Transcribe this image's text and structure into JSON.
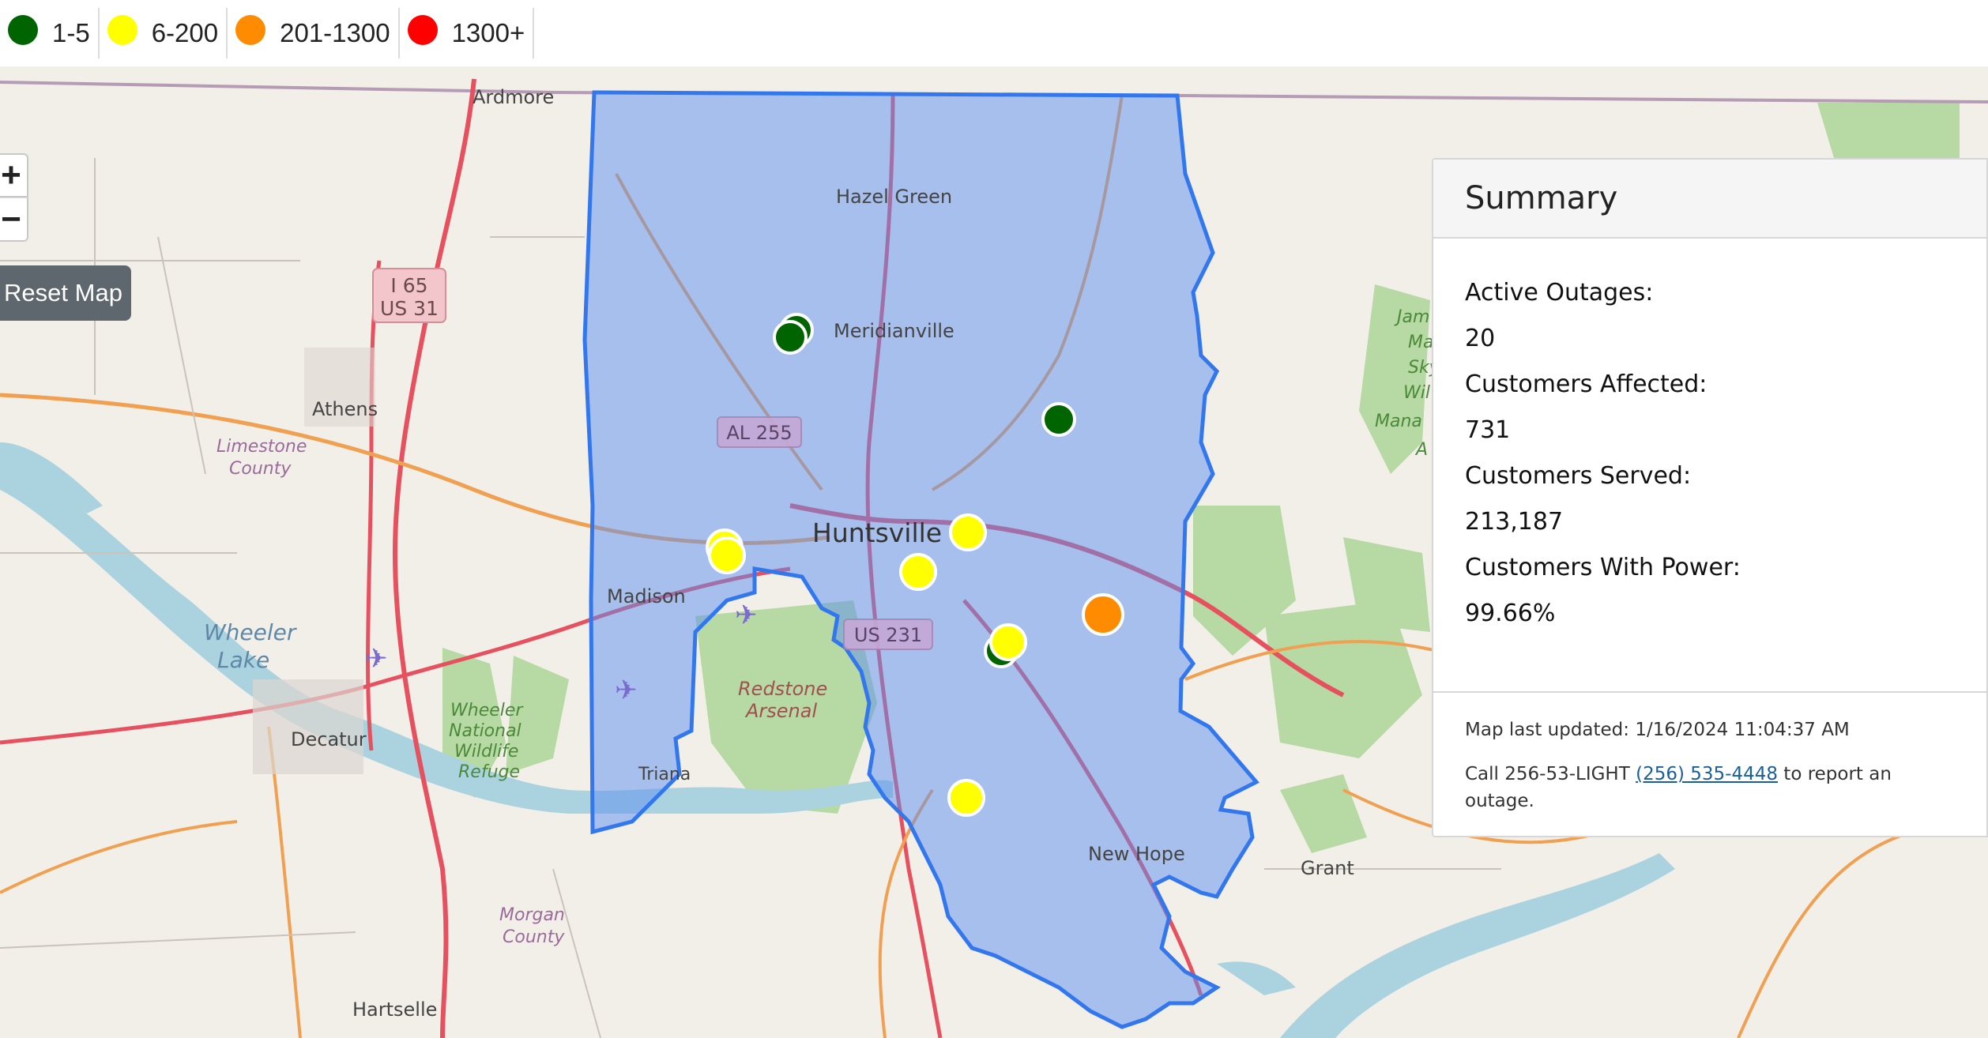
{
  "legend": [
    {
      "color": "#006400",
      "label": "1-5"
    },
    {
      "color": "#ffff00",
      "label": "6-200"
    },
    {
      "color": "#ff8c00",
      "label": "201-1300"
    },
    {
      "color": "#ff0000",
      "label": "1300+"
    }
  ],
  "controls": {
    "zoom_in": "+",
    "zoom_out": "−",
    "reset": "Reset Map"
  },
  "map_labels": {
    "ardmore": "Ardmore",
    "hazel_green": "Hazel Green",
    "meridianville": "Meridianville",
    "athens": "Athens",
    "limestone_1": "Limestone",
    "limestone_2": "County",
    "huntsville": "Huntsville",
    "madison": "Madison",
    "wheeler_1": "Wheeler",
    "wheeler_2": "Lake",
    "decatur": "Decatur",
    "refuge_1": "Wheeler",
    "refuge_2": "National",
    "refuge_3": "Wildlife",
    "refuge_4": "Refuge",
    "triana": "Triana",
    "redstone_1": "Redstone",
    "redstone_2": "Arsenal",
    "morgan_1": "Morgan",
    "morgan_2": "County",
    "hartselle": "Hartselle",
    "new_hope": "New Hope",
    "grant": "Grant",
    "i65": "I 65",
    "us31": "US 31",
    "al255": "AL 255",
    "us231": "US 231",
    "james_1": "Jam",
    "james_2": "Ma",
    "james_3": "Sky",
    "james_4": "Wil",
    "james_5": "Mana",
    "james_6": "A"
  },
  "outage_markers": [
    {
      "category": "1-5",
      "color": "#006400"
    },
    {
      "category": "1-5",
      "color": "#006400"
    },
    {
      "category": "1-5",
      "color": "#006400"
    },
    {
      "category": "1-5",
      "color": "#006400"
    },
    {
      "category": "6-200",
      "color": "#ffff00"
    },
    {
      "category": "6-200",
      "color": "#ffff00"
    },
    {
      "category": "6-200",
      "color": "#ffff00"
    },
    {
      "category": "6-200",
      "color": "#ffff00"
    },
    {
      "category": "6-200",
      "color": "#ffff00"
    },
    {
      "category": "6-200",
      "color": "#ffff00"
    },
    {
      "category": "201-1300",
      "color": "#ff8c00"
    }
  ],
  "summary": {
    "title": "Summary",
    "active_outages_label": "Active Outages:",
    "active_outages": "20",
    "customers_affected_label": "Customers Affected:",
    "customers_affected": "731",
    "customers_served_label": "Customers Served:",
    "customers_served": "213,187",
    "customers_with_power_label": "Customers With Power:",
    "customers_with_power": "99.66%",
    "last_updated": "Map last updated: 1/16/2024 11:04:37 AM",
    "report_prefix": "Call 256-53-LIGHT ",
    "phone": "(256) 535-4448",
    "report_suffix": " to report an outage."
  }
}
